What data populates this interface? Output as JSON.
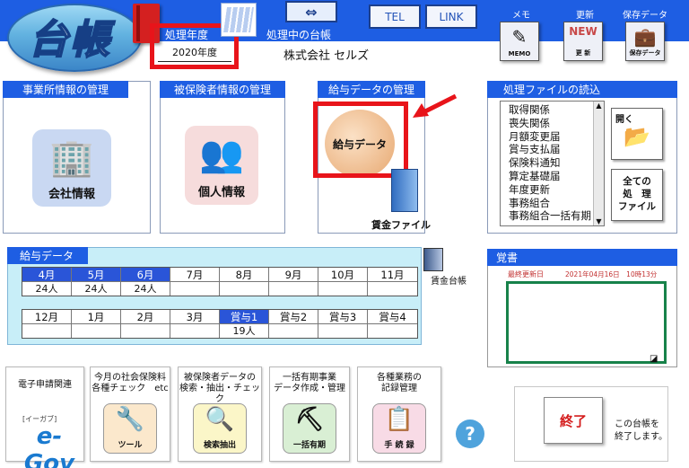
{
  "header": {
    "logo_text": "台帳",
    "fiscal_year_label": "処理年度",
    "fiscal_year_value": "2020年度",
    "ledger_label": "処理中の台帳",
    "company_name": "株式会社 セルズ",
    "arrow_button": "⇔",
    "tel_label": "TEL",
    "link_label": "LINK",
    "memo_label": "メモ",
    "memo_icon_text": "MEMO",
    "update_label": "更新",
    "update_icon_text": "NEW",
    "update_icon_sub": "更 新",
    "save_label": "保存データ",
    "save_icon_text": "保存データ"
  },
  "office_panel": {
    "title": "事業所情報の管理",
    "button_label": "会社情報"
  },
  "insured_panel": {
    "title": "被保険者情報の管理",
    "button_label": "個人情報"
  },
  "salary_panel": {
    "title": "給与データの管理",
    "button_label": "給与データ",
    "file_label": "賃金ファイル"
  },
  "file_panel": {
    "title": "処理ファイルの読込",
    "items": [
      "取得関係",
      "喪失関係",
      "月額変更届",
      "賞与支払届",
      "保険料通知",
      "算定基礎届",
      "年度更新",
      "事務組合",
      "事務組合一括有期"
    ],
    "open_label": "開く",
    "all_files_label": "全ての\n処　理\nファイル"
  },
  "salary_data": {
    "title": "給与データ",
    "ledger_label": "賃金台帳",
    "row1": [
      {
        "month": "4月",
        "value": "24人",
        "selected": true
      },
      {
        "month": "5月",
        "value": "24人",
        "selected": true
      },
      {
        "month": "6月",
        "value": "24人",
        "selected": true
      },
      {
        "month": "7月",
        "value": "",
        "selected": false
      },
      {
        "month": "8月",
        "value": "",
        "selected": false
      },
      {
        "month": "9月",
        "value": "",
        "selected": false
      },
      {
        "month": "10月",
        "value": "",
        "selected": false
      },
      {
        "month": "11月",
        "value": "",
        "selected": false
      }
    ],
    "row2": [
      {
        "month": "12月",
        "value": "",
        "selected": false
      },
      {
        "month": "1月",
        "value": "",
        "selected": false
      },
      {
        "month": "2月",
        "value": "",
        "selected": false
      },
      {
        "month": "3月",
        "value": "",
        "selected": false
      },
      {
        "month": "賞与1",
        "value": "19人",
        "selected": true
      },
      {
        "month": "賞与2",
        "value": "",
        "selected": false
      },
      {
        "month": "賞与3",
        "value": "",
        "selected": false
      },
      {
        "month": "賞与4",
        "value": "",
        "selected": false
      }
    ]
  },
  "memo": {
    "title": "覚書",
    "last_updated_label": "最終更新日",
    "last_updated_value": "2021年04月16日　10時13分"
  },
  "tools": {
    "egov_title": "電子申請関連",
    "egov_logo": "e-Gov",
    "egov_sub": "[イーガブ]",
    "social_title": "今月の社会保険料\n各種チェック　etc",
    "social_btn": "ツール",
    "search_title": "被保険者データの\n検索・抽出・チェック",
    "search_btn": "検索抽出",
    "lump_title": "一括有期事業\nデータ作成・管理",
    "lump_btn": "一括有期",
    "record_title": "各種業務の\n記録管理",
    "record_btn": "手 続 録"
  },
  "help_icon": "?",
  "exit": {
    "button_label": "終了",
    "note": "この台帳を\n終了します。"
  },
  "colors": {
    "header_blue": "#1e5ee3",
    "highlight_red": "#e8141a",
    "memo_green": "#17824a",
    "salary_bg": "#c8eef8"
  }
}
